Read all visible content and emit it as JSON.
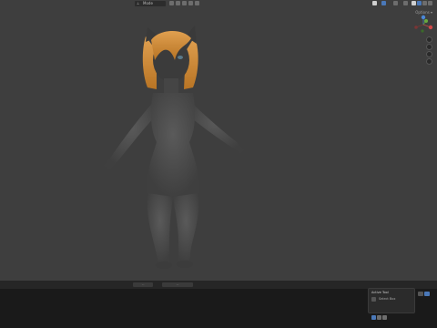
{
  "header": {
    "object_mode": "Mode",
    "orientation_glyph": "⊥"
  },
  "viewport": {
    "options_label": "Options ▾",
    "gizmo_axes": [
      "X",
      "Y",
      "Z"
    ]
  },
  "timeline": {
    "field_left": "...",
    "field_center": "..."
  },
  "operator_panel": {
    "title": "Active Tool",
    "row_label": "Select Box"
  },
  "colors": {
    "viewport_bg": "#3e3e3e",
    "hair": "#d08a34",
    "fur": "#4b4b4b",
    "accent": "#4a78b8"
  },
  "icons": [
    "cursor-icon",
    "view-icon",
    "grid-icon",
    "camera-icon",
    "hand-icon",
    "zoom-icon",
    "shading-solid-icon",
    "shading-wire-icon",
    "overlay-icon",
    "tool-icon"
  ]
}
